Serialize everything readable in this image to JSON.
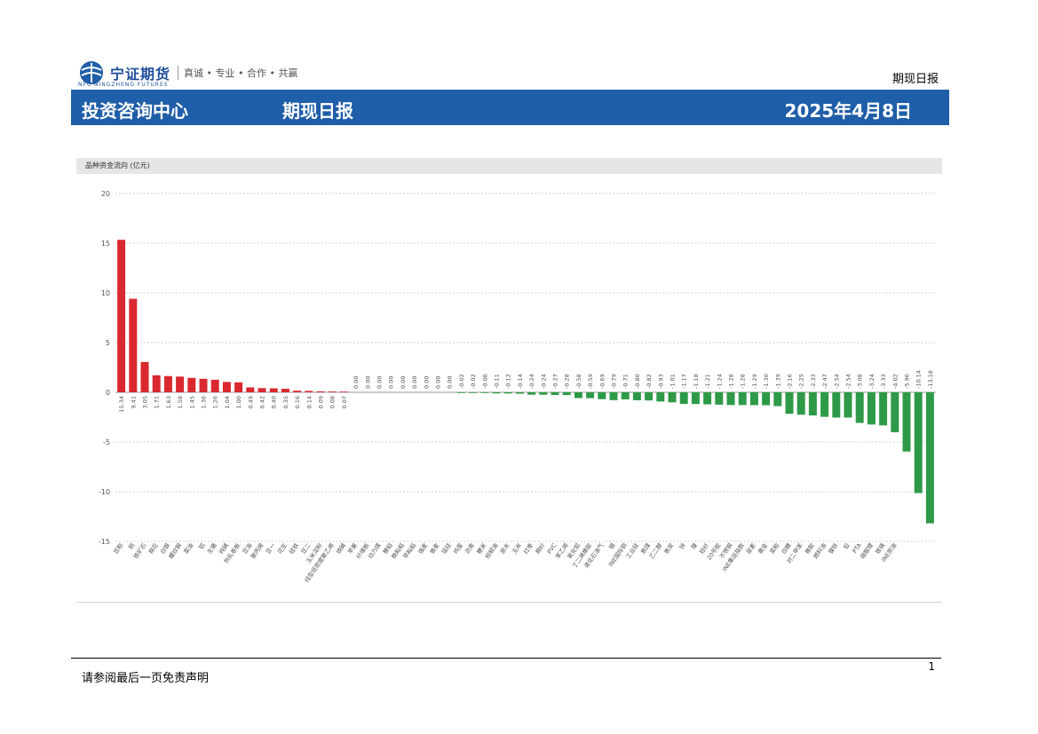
{
  "header": {
    "logo_name": "宁证期货",
    "logo_slogan": "真诚 • 专业 • 合作 • 共赢",
    "logo_sub": "NFC NINGZHENG FUTURES",
    "top_right": "期现日报",
    "banner_left": "投资咨询中心",
    "banner_mid": "期现日报",
    "banner_right": "2025年4月8日",
    "accent": "#1f5ea8"
  },
  "chart_data": {
    "type": "bar",
    "title": "品种资金流向 (亿元)",
    "ylim": [
      -15,
      20
    ],
    "yticks": [
      20,
      15,
      10,
      5,
      0,
      -5,
      -10,
      -15
    ],
    "grid": true,
    "positive_color": "#d9282f",
    "negative_color": "#2e9a47",
    "categories": [
      "豆粕",
      "铜",
      "铁矿石",
      "棉花",
      "白银",
      "螺纹钢",
      "菜油",
      "铝",
      "生猪",
      "纯碱",
      "热轧卷板",
      "豆油",
      "聚丙烯",
      "豆一",
      "花生",
      "硅铁",
      "豆二",
      "玉米淀粉",
      "线型低密度聚乙烯",
      "烧碱",
      "苹果",
      "纤维板",
      "动力煤",
      "粳稻",
      "晚籼稻",
      "早籼稻",
      "强麦",
      "普麦",
      "锰硅",
      "鸡蛋",
      "沥青",
      "粳米",
      "棕榈油",
      "原木",
      "玉米",
      "红枣",
      "棉纱",
      "PVC",
      "苯乙烯",
      "氧化铝",
      "丁二烯橡胶",
      "液化石油气",
      "锡",
      "INE国际铜",
      "工业硅",
      "焦煤",
      "乙二醇",
      "焦炭",
      "锌",
      "镍",
      "短纤",
      "20号胶",
      "不锈钢",
      "INE集运指数",
      "尿素",
      "黄金",
      "菜粕",
      "白糖",
      "对二甲苯",
      "橡胶",
      "燃料油",
      "镍铁",
      "铅",
      "PTA",
      "碳酸锂",
      "玻璃",
      "INE原油"
    ],
    "values": [
      15.34,
      9.41,
      3.05,
      1.71,
      1.63,
      1.58,
      1.45,
      1.36,
      1.26,
      1.04,
      1.0,
      0.49,
      0.42,
      0.4,
      0.35,
      0.16,
      0.14,
      0.09,
      0.08,
      0.07,
      0.0,
      0.0,
      0.0,
      0.0,
      0.0,
      0.0,
      0.0,
      0.0,
      0.0,
      -0.02,
      -0.02,
      -0.06,
      -0.11,
      -0.12,
      -0.14,
      -0.24,
      -0.24,
      -0.27,
      -0.28,
      -0.58,
      -0.59,
      -0.69,
      -0.79,
      -0.71,
      -0.8,
      -0.82,
      -0.93,
      -1.01,
      -1.17,
      -1.18,
      -1.21,
      -1.24,
      -1.28,
      -1.28,
      -1.29,
      -1.3,
      -1.39,
      -2.16,
      -2.25,
      -2.33,
      -2.47,
      -2.54,
      -2.54,
      -3.08,
      -3.24,
      -3.33,
      -4.02,
      -5.96,
      -10.14,
      -13.18
    ],
    "xlabel": "",
    "ylabel": ""
  },
  "footer": {
    "disclaimer": "请参阅最后一页免责声明",
    "page": "1"
  }
}
